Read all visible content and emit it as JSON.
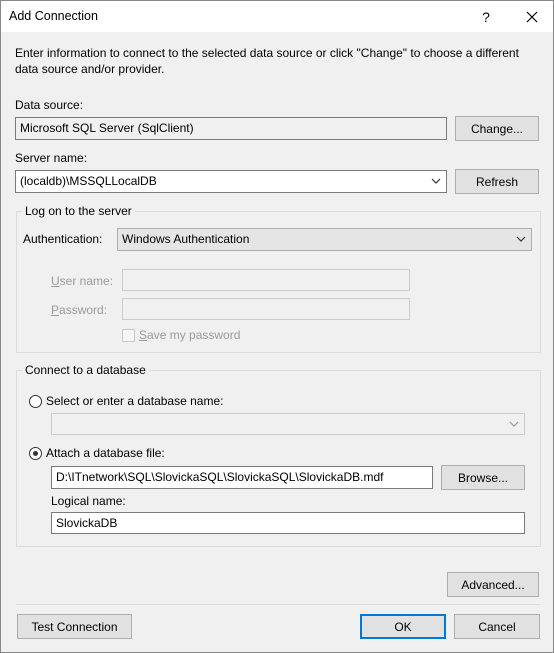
{
  "window": {
    "title": "Add Connection",
    "help_label": "?",
    "close_icon": "close-icon"
  },
  "intro": {
    "line1": "Enter information to connect to the selected data source or click \"Change\" to choose a different",
    "line2": "data source and/or provider."
  },
  "data_source": {
    "label": "Data source:",
    "value": "Microsoft SQL Server (SqlClient)",
    "change_label": "Change..."
  },
  "server": {
    "label": "Server name:",
    "value": "(localdb)\\MSSQLLocalDB",
    "refresh_label": "Refresh"
  },
  "logon": {
    "group_title": "Log on to the server",
    "auth_label": "Authentication:",
    "auth_value": "Windows Authentication",
    "username_label_u": "U",
    "username_label_rest": "ser name:",
    "password_label_p": "P",
    "password_label_rest": "assword:",
    "save_password_s": "S",
    "save_password_rest": "ave my password"
  },
  "database": {
    "group_title": "Connect to a database",
    "select_option_label": "Select or enter a database name:",
    "select_option_checked": false,
    "attach_option_label": "Attach a database file:",
    "attach_option_checked": true,
    "file_path": "D:\\ITnetwork\\SQL\\SlovickaSQL\\SlovickaSQL\\SlovickaDB.mdf",
    "browse_label": "Browse...",
    "logical_name_label": "Logical name:",
    "logical_name_value": "SlovickaDB"
  },
  "footer": {
    "advanced_label": "Advanced...",
    "test_label": "Test Connection",
    "ok_label": "OK",
    "cancel_label": "Cancel"
  },
  "colors": {
    "accent": "#0078d7",
    "dialog_bg": "#f0f0f0",
    "button_bg": "#e1e1e1"
  }
}
